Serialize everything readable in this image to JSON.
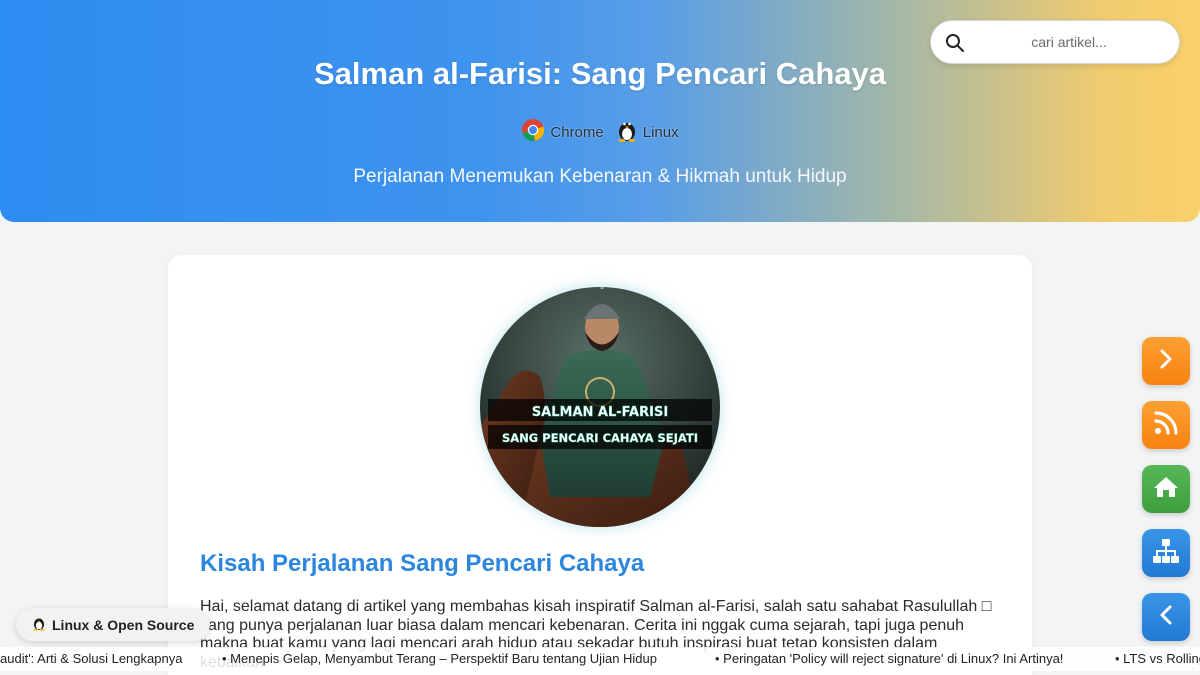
{
  "header": {
    "title": "Salman al-Farisi: Sang Pencari Cahaya",
    "subtitle": "Perjalanan Menemukan Kebenaran & Hikmah untuk Hidup",
    "badges": [
      {
        "label": "Chrome",
        "icon": "chrome-icon"
      },
      {
        "label": "Linux",
        "icon": "tux-penguin-icon"
      }
    ]
  },
  "search": {
    "placeholder": "cari artikel...",
    "value": ""
  },
  "article": {
    "image": {
      "line1": "SALMAN AL-FARISI",
      "line2": "SANG PENCARI CAHAYA SEJATI"
    },
    "title": "Kisah Perjalanan Sang Pencari Cahaya",
    "paragraph": "Hai, selamat datang di artikel yang membahas kisah inspiratif Salman al-Farisi, salah satu sahabat Rasulullah □ yang punya perjalanan luar biasa dalam mencari kebenaran. Cerita ini nggak cuma sejarah, tapi juga penuh makna buat kamu yang lagi mencari arah hidup atau sekadar butuh inspirasi buat tetap konsisten dalam kebaikan."
  },
  "side_buttons": [
    {
      "name": "next-button",
      "icon": "chevron-right-icon",
      "color": "#f7820f"
    },
    {
      "name": "rss-button",
      "icon": "rss-icon",
      "color": "#f7820f"
    },
    {
      "name": "home-button",
      "icon": "home-icon",
      "color": "#3d9e3d"
    },
    {
      "name": "sitemap-button",
      "icon": "sitemap-icon",
      "color": "#2279d3"
    },
    {
      "name": "back-button",
      "icon": "chevron-left-icon",
      "color": "#2279d3"
    }
  ],
  "linux_badge": {
    "label": "Linux & Open Source",
    "icon": "tux-penguin-icon"
  },
  "ticker": [
    "audit': Arti & Solusi Lengkapnya",
    "• Menepis Gelap, Menyambut Terang – Perspektif Baru tentang Ujian Hidup",
    "• Peringatan 'Policy will reject signature' di Linux? Ini Artinya!",
    "• LTS vs Rolling"
  ],
  "colors": {
    "accent_blue": "#2d86dd",
    "gradient_start": "#2d8cf0",
    "gradient_end": "#f9d06a"
  }
}
